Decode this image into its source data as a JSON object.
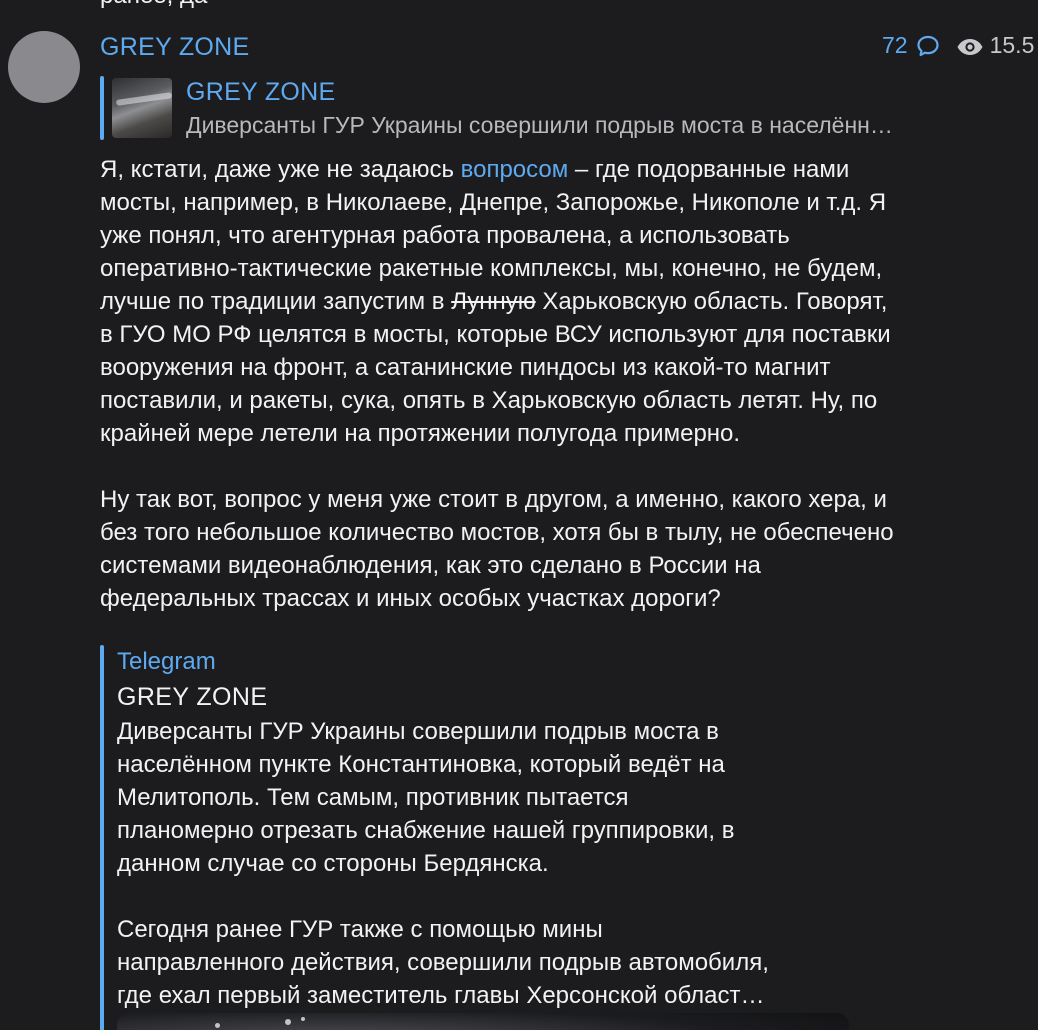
{
  "previous_message": {
    "text": "ранее, да"
  },
  "post": {
    "sender": "GREY ZONE",
    "comments_count": "72",
    "views_count": "15.5",
    "icons": {
      "comment": "comment-bubble-icon",
      "views": "eye-icon"
    },
    "reply": {
      "title": "GREY ZONE",
      "snippet": "Диверсанты ГУР Украины совершили подрыв моста в населённ…"
    },
    "body": {
      "l1_pre": "Я, кстати, даже уже не задаюсь ",
      "l1_link": "вопросом",
      "l1_post": " – где подорванные нами",
      "l2": "мосты, например, в Николаеве, Днепре, Запорожье, Никополе и т.д. Я",
      "l3": "уже понял, что агентурная работа провалена, а использовать",
      "l4": "оперативно-тактические ракетные комплексы, мы, конечно, не будем,",
      "l5_pre": "лучше по традиции запустим в ",
      "l5_strike": "Лунную",
      "l5_post": " Харьковскую область. Говорят,",
      "l6": "в ГУО МО РФ целятся в мосты, которые ВСУ используют для поставки",
      "l7": "вооружения на фронт, а сатанинские пиндосы из какой-то магнит",
      "l8": "поставили, и ракеты, сука, опять в Харьковскую область летят. Ну, по",
      "l9": "крайней мере летели на протяжении полугода примерно.",
      "l10": "Ну так вот, вопрос у меня уже стоит в другом, а именно, какого хера, и",
      "l11": "без того небольшое количество мостов, хотя бы в тылу, не обеспечено",
      "l12": "системами видеонаблюдения, как это сделано в России на",
      "l13": "федеральных трассах и иных особых участках дороги?"
    },
    "link_preview": {
      "site_name": "Telegram",
      "title": "GREY ZONE",
      "description_lines": [
        "Диверсанты ГУР Украины совершили подрыв моста в",
        "населённом пункте Константиновка, который ведёт на",
        "Мелитополь. Тем самым, противник пытается",
        "планомерно отрезать снабжение нашей группировки, в",
        "данном случае со стороны Бердянска.",
        "",
        "Сегодня ранее ГУР также с помощью мины",
        "направленного действия, совершили подрыв автомобиля,",
        "где ехал первый заместитель главы Херсонской област…"
      ]
    }
  },
  "colors": {
    "background": "#1c1c1e",
    "accent": "#5eaaf0",
    "text": "#f2f2f4",
    "muted": "#b8b8bd"
  }
}
